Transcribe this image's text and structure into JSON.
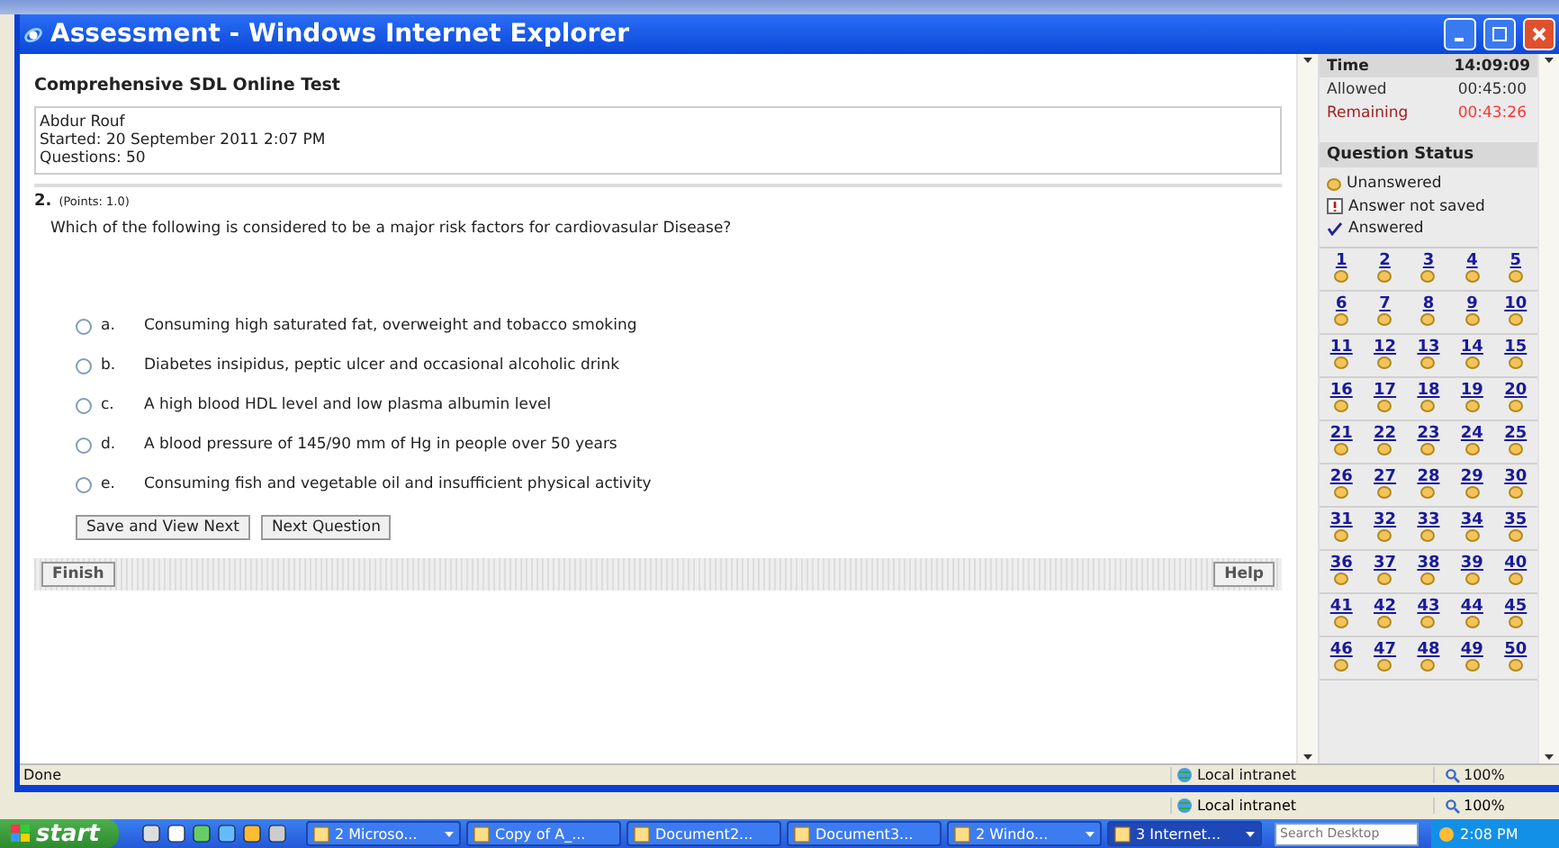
{
  "window": {
    "title": "Assessment - Windows Internet Explorer"
  },
  "test": {
    "title": "Comprehensive SDL Online Test",
    "info": [
      "Abdur Rouf",
      "Started: 20 September 2011 2:07 PM",
      "Questions: 50"
    ]
  },
  "question": {
    "number": "2.",
    "points": "(Points: 1.0)",
    "text": "Which of the following is considered to be a major risk factors for cardiovasular Disease?",
    "options": [
      {
        "letter": "a.",
        "text": "Consuming high saturated fat, overweight and tobacco smoking",
        "selected": false
      },
      {
        "letter": "b.",
        "text": "Diabetes insipidus, peptic ulcer and occasional alcoholic drink",
        "selected": false
      },
      {
        "letter": "c.",
        "text": "A high blood HDL level and low plasma albumin level",
        "selected": false
      },
      {
        "letter": "d.",
        "text": "A blood pressure of 145/90 mm of Hg in people over 50 years",
        "selected": false
      },
      {
        "letter": "e.",
        "text": "Consuming fish and vegetable oil and insufficient physical activity",
        "selected": false
      }
    ]
  },
  "buttons": [
    "Save and View Next",
    "Next Question"
  ],
  "footer": {
    "finish": "Finish",
    "help": "Help"
  },
  "timer": {
    "label": "Time",
    "value": "14:09:09",
    "rows": [
      {
        "label": "Allowed",
        "value": "00:45:00",
        "kind": "normal"
      },
      {
        "label": "Remaining",
        "value": "00:43:26",
        "kind": "alert"
      }
    ]
  },
  "question_status": {
    "title": "Question Status",
    "legend": [
      {
        "kind": "unanswered",
        "label": "Unanswered"
      },
      {
        "kind": "unsaved",
        "label": "Answer not saved"
      },
      {
        "kind": "answered",
        "label": "Answered"
      }
    ],
    "questions": [
      {
        "number": "1",
        "kind": "unanswered"
      },
      {
        "number": "2",
        "kind": "unanswered"
      },
      {
        "number": "3",
        "kind": "unanswered"
      },
      {
        "number": "4",
        "kind": "unanswered"
      },
      {
        "number": "5",
        "kind": "unanswered"
      },
      {
        "number": "6",
        "kind": "unanswered"
      },
      {
        "number": "7",
        "kind": "unanswered"
      },
      {
        "number": "8",
        "kind": "unanswered"
      },
      {
        "number": "9",
        "kind": "unanswered"
      },
      {
        "number": "10",
        "kind": "unanswered"
      },
      {
        "number": "11",
        "kind": "unanswered"
      },
      {
        "number": "12",
        "kind": "unanswered"
      },
      {
        "number": "13",
        "kind": "unanswered"
      },
      {
        "number": "14",
        "kind": "unanswered"
      },
      {
        "number": "15",
        "kind": "unanswered"
      },
      {
        "number": "16",
        "kind": "unanswered"
      },
      {
        "number": "17",
        "kind": "unanswered"
      },
      {
        "number": "18",
        "kind": "unanswered"
      },
      {
        "number": "19",
        "kind": "unanswered"
      },
      {
        "number": "20",
        "kind": "unanswered"
      },
      {
        "number": "21",
        "kind": "unanswered"
      },
      {
        "number": "22",
        "kind": "unanswered"
      },
      {
        "number": "23",
        "kind": "unanswered"
      },
      {
        "number": "24",
        "kind": "unanswered"
      },
      {
        "number": "25",
        "kind": "unanswered"
      },
      {
        "number": "26",
        "kind": "unanswered"
      },
      {
        "number": "27",
        "kind": "unanswered"
      },
      {
        "number": "28",
        "kind": "unanswered"
      },
      {
        "number": "29",
        "kind": "unanswered"
      },
      {
        "number": "30",
        "kind": "unanswered"
      },
      {
        "number": "31",
        "kind": "unanswered"
      },
      {
        "number": "32",
        "kind": "unanswered"
      },
      {
        "number": "33",
        "kind": "unanswered"
      },
      {
        "number": "34",
        "kind": "unanswered"
      },
      {
        "number": "35",
        "kind": "unanswered"
      },
      {
        "number": "36",
        "kind": "unanswered"
      },
      {
        "number": "37",
        "kind": "unanswered"
      },
      {
        "number": "38",
        "kind": "unanswered"
      },
      {
        "number": "39",
        "kind": "unanswered"
      },
      {
        "number": "40",
        "kind": "unanswered"
      },
      {
        "number": "41",
        "kind": "unanswered"
      },
      {
        "number": "42",
        "kind": "unanswered"
      },
      {
        "number": "43",
        "kind": "unanswered"
      },
      {
        "number": "44",
        "kind": "unanswered"
      },
      {
        "number": "45",
        "kind": "unanswered"
      },
      {
        "number": "46",
        "kind": "unanswered"
      },
      {
        "number": "47",
        "kind": "unanswered"
      },
      {
        "number": "48",
        "kind": "unanswered"
      },
      {
        "number": "49",
        "kind": "unanswered"
      },
      {
        "number": "50",
        "kind": "unanswered"
      }
    ]
  },
  "status_bar": {
    "text": "Done",
    "zone": "Local intranet",
    "zoom": "100%"
  },
  "back_status_bar": {
    "zone": "Local intranet",
    "zoom": "100%"
  },
  "taskbar": {
    "start": "start",
    "tasks": [
      {
        "label": "2 Microso...",
        "menu": true,
        "selected": false
      },
      {
        "label": "Copy of A_...",
        "menu": false,
        "selected": false
      },
      {
        "label": "Document2...",
        "menu": false,
        "selected": false
      },
      {
        "label": "Document3...",
        "menu": false,
        "selected": false
      },
      {
        "label": "2 Windo...",
        "menu": true,
        "selected": false
      },
      {
        "label": "3 Internet...",
        "menu": true,
        "selected": true
      }
    ],
    "search": {
      "placeholder": "Search Desktop"
    },
    "clock": "2:08 PM"
  }
}
